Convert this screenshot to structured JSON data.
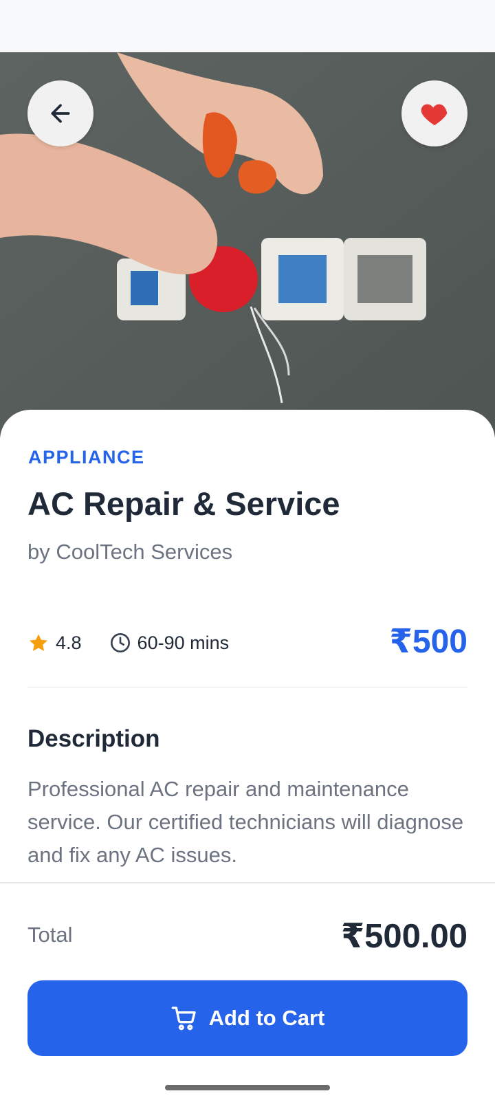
{
  "app": {
    "colors": {
      "accent": "#2563eb",
      "heart": "#e53935",
      "star": "#f59e0b"
    }
  },
  "hero": {
    "back_icon": "arrow-left-icon",
    "favorite_icon": "heart-icon"
  },
  "service": {
    "category": "APPLIANCE",
    "title": "AC Repair & Service",
    "provider": "by CoolTech Services",
    "rating": "4.8",
    "duration": "60-90 mins",
    "price": "₹500",
    "description_heading": "Description",
    "description": "Professional AC repair and maintenance service. Our certified technicians will diagnose and fix any AC issues."
  },
  "checkout": {
    "total_label": "Total",
    "total_value": "₹500.00",
    "add_to_cart_label": "Add to Cart",
    "cart_icon": "cart-icon"
  }
}
